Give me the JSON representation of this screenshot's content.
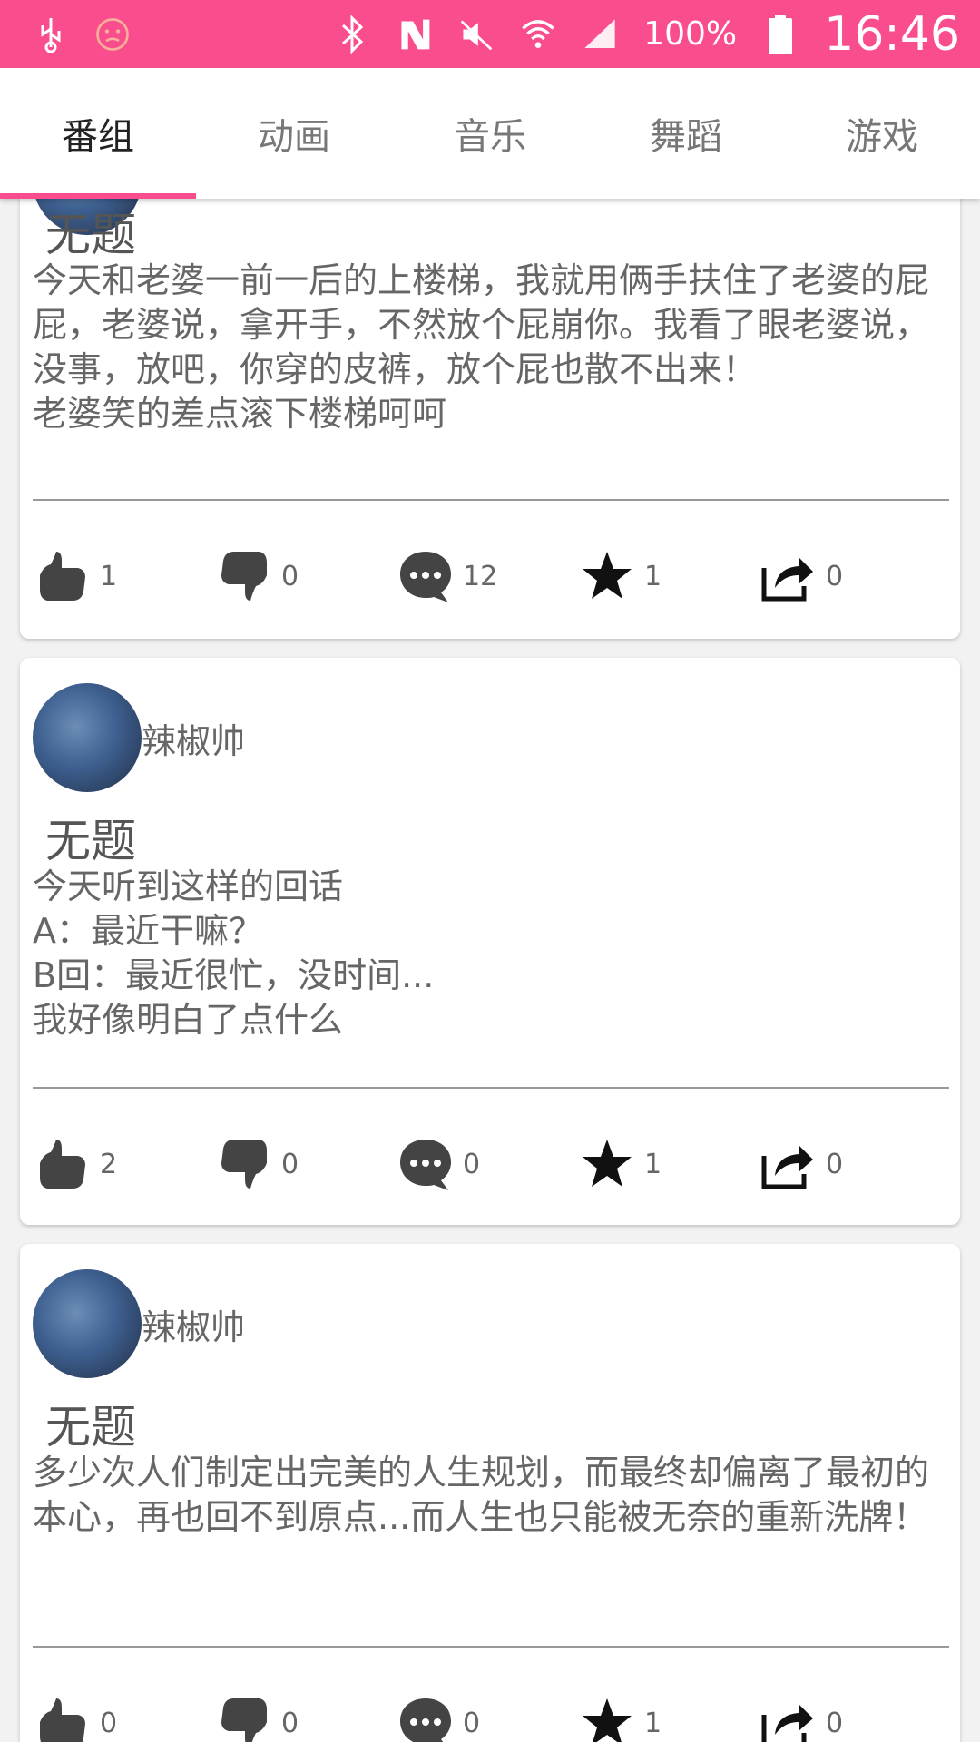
{
  "status_bar": {
    "battery": "100%",
    "time": "16:46"
  },
  "tabs": [
    {
      "label": "番组",
      "active": true
    },
    {
      "label": "动画",
      "active": false
    },
    {
      "label": "音乐",
      "active": false
    },
    {
      "label": "舞蹈",
      "active": false
    },
    {
      "label": "游戏",
      "active": false
    }
  ],
  "posts": [
    {
      "author": "",
      "title": "无题",
      "body": "今天和老婆一前一后的上楼梯，我就用俩手扶住了老婆的屁屁，老婆说，拿开手，不然放个屁崩你。我看了眼老婆说，没事，放吧，你穿的皮裤，放个屁也散不出来！\n老婆笑的差点滚下楼梯呵呵",
      "likes": "1",
      "dislikes": "0",
      "comments": "12",
      "favorites": "1",
      "shares": "0"
    },
    {
      "author": "辣椒帅",
      "title": "无题",
      "body": "今天听到这样的回话\nA：最近干嘛？\nB回：最近很忙，没时间...\n我好像明白了点什么",
      "likes": "2",
      "dislikes": "0",
      "comments": "0",
      "favorites": "1",
      "shares": "0"
    },
    {
      "author": "辣椒帅",
      "title": "无题",
      "body": "多少次人们制定出完美的人生规划，而最终却偏离了最初的本心，再也回不到原点...而人生也只能被无奈的重新洗牌！",
      "likes": "0",
      "dislikes": "0",
      "comments": "0",
      "favorites": "1",
      "shares": "0"
    }
  ],
  "colors": {
    "accent": "#fa4d8e"
  }
}
